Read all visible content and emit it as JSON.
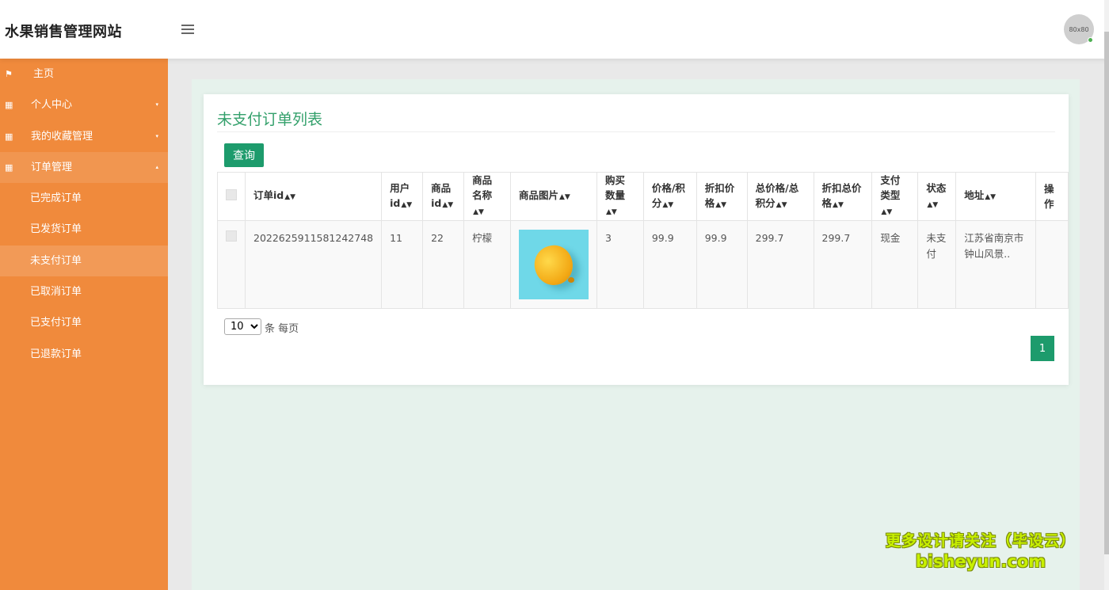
{
  "app": {
    "title": "水果销售管理网站",
    "avatar_text": "80x80"
  },
  "sidebar": {
    "items": [
      {
        "label": "主页",
        "icon": "flag-icon"
      },
      {
        "label": "个人中心",
        "icon": "grid-icon",
        "caret": "▾"
      },
      {
        "label": "我的收藏管理",
        "icon": "grid-icon",
        "caret": "▾"
      },
      {
        "label": "订单管理",
        "icon": "grid-icon",
        "caret": "▴"
      }
    ],
    "sub_items": [
      "已完成订单",
      "已发货订单",
      "未支付订单",
      "已取消订单",
      "已支付订单",
      "已退款订单"
    ],
    "active_sub": "未支付订单"
  },
  "panel": {
    "title": "未支付订单列表",
    "query_label": "查询"
  },
  "table": {
    "headers": [
      {
        "line1": "订单id",
        "line2": ""
      },
      {
        "line1": "用户",
        "line2": "id"
      },
      {
        "line1": "商品",
        "line2": "id"
      },
      {
        "line1": "商品",
        "line2": "名称"
      },
      {
        "line1": "商品图片",
        "line2": ""
      },
      {
        "line1": "购买",
        "line2": "数量"
      },
      {
        "line1": "价格/积",
        "line2": "分"
      },
      {
        "line1": "折扣价",
        "line2": "格"
      },
      {
        "line1": "总价格/总",
        "line2": "积分"
      },
      {
        "line1": "折扣总价",
        "line2": "格"
      },
      {
        "line1": "支付",
        "line2": "类型"
      },
      {
        "line1": "状态",
        "line2": ""
      },
      {
        "line1": "地址",
        "line2": ""
      },
      {
        "line1": "操",
        "line2": "作"
      }
    ],
    "rows": [
      {
        "order_id": "2022625911581242748",
        "user_id": "11",
        "product_id": "22",
        "product_name": "柠檬",
        "image": "lemon-image",
        "quantity": "3",
        "price": "99.9",
        "discount_price": "99.9",
        "total_price": "299.7",
        "discount_total": "299.7",
        "pay_type": "现金",
        "status": "未支付",
        "address": "江苏省南京市钟山风景.."
      }
    ]
  },
  "pagination": {
    "page_size": "10",
    "page_size_options": [
      "10"
    ],
    "per_page_text": "条 每页",
    "current_page": "1"
  },
  "watermark": {
    "line1": "更多设计请关注（毕设云）",
    "line2": "bisheyun.com"
  },
  "colors": {
    "sidebar": "#f08a3c",
    "accent_green": "#1d9b6c",
    "title_green": "#33a06b",
    "main_bg": "#e6f2ec"
  }
}
